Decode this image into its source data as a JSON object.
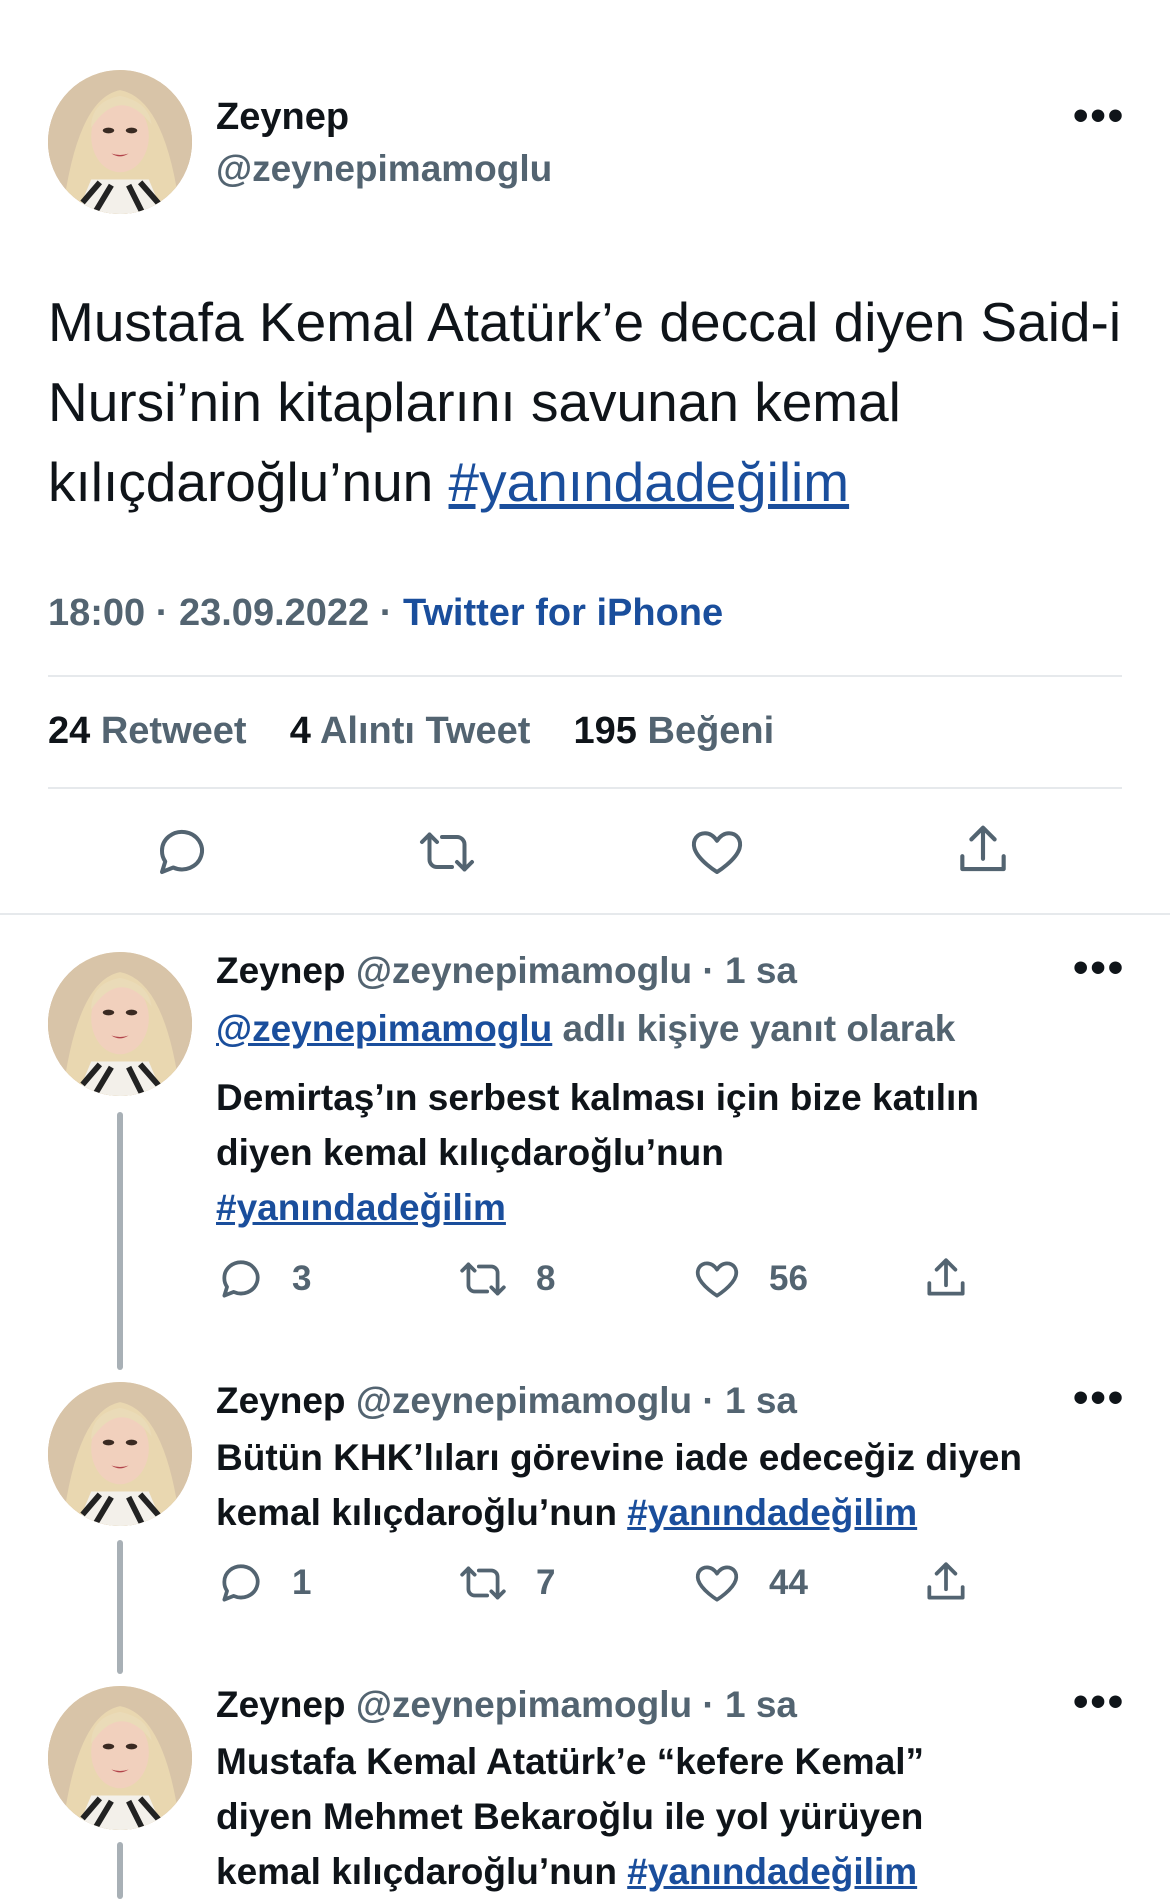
{
  "main_tweet": {
    "author_name": "Zeynep",
    "author_handle": "@zeynepimamoglu",
    "text": "Mustafa Kemal Atatürk’e deccal diyen Said-i Nursi’nin kitaplarını savunan kemal kılıçdaroğlu’nun",
    "hashtag": "#yanındadeğilim",
    "time": "18:00",
    "separator": "·",
    "date": "23.09.2022",
    "source": "Twitter for iPhone",
    "stats": {
      "retweets_count": "24",
      "retweets_label": "Retweet",
      "quotes_count": "4",
      "quotes_label": "Alıntı Tweet",
      "likes_count": "195",
      "likes_label": "Beğeni"
    }
  },
  "replies": [
    {
      "author_name": "Zeynep",
      "author_handle": "@zeynepimamoglu",
      "time": "· 1 sa",
      "reply_to_handle": "@zeynepimamoglu",
      "reply_to_text": "adlı kişiye yanıt olarak",
      "line1": "Demirtaş’ın serbest kalması için bize katılın",
      "line2": "diyen kemal kılıçdaroğlu’nun",
      "hashtag": "#yanındadeğilim",
      "replies_count": "3",
      "retweets_count": "8",
      "likes_count": "56"
    },
    {
      "author_name": "Zeynep",
      "author_handle": "@zeynepimamoglu",
      "time": "· 1 sa",
      "line1": "Bütün KHK’lıları görevine iade edeceğiz diyen",
      "line2": "kemal kılıçdaroğlu’nun",
      "hashtag": "#yanındadeğilim",
      "replies_count": "1",
      "retweets_count": "7",
      "likes_count": "44"
    },
    {
      "author_name": "Zeynep",
      "author_handle": "@zeynepimamoglu",
      "time": "· 1 sa",
      "line1": "Mustafa Kemal Atatürk’e “kefere Kemal”",
      "line2": "diyen Mehmet Bekaroğlu ile yol yürüyen",
      "line3": "kemal kılıçdaroğlu’nun",
      "hashtag": "#yanındadeğilim"
    }
  ],
  "icons": {
    "more": "more-horizontal-icon",
    "reply": "reply-bubble-icon",
    "retweet": "retweet-arrows-icon",
    "like": "heart-icon",
    "share": "share-upload-icon"
  },
  "colors": {
    "link": "#1a4e9c",
    "muted": "#536471",
    "text": "#0f1419",
    "divider": "#e6e9ec"
  }
}
